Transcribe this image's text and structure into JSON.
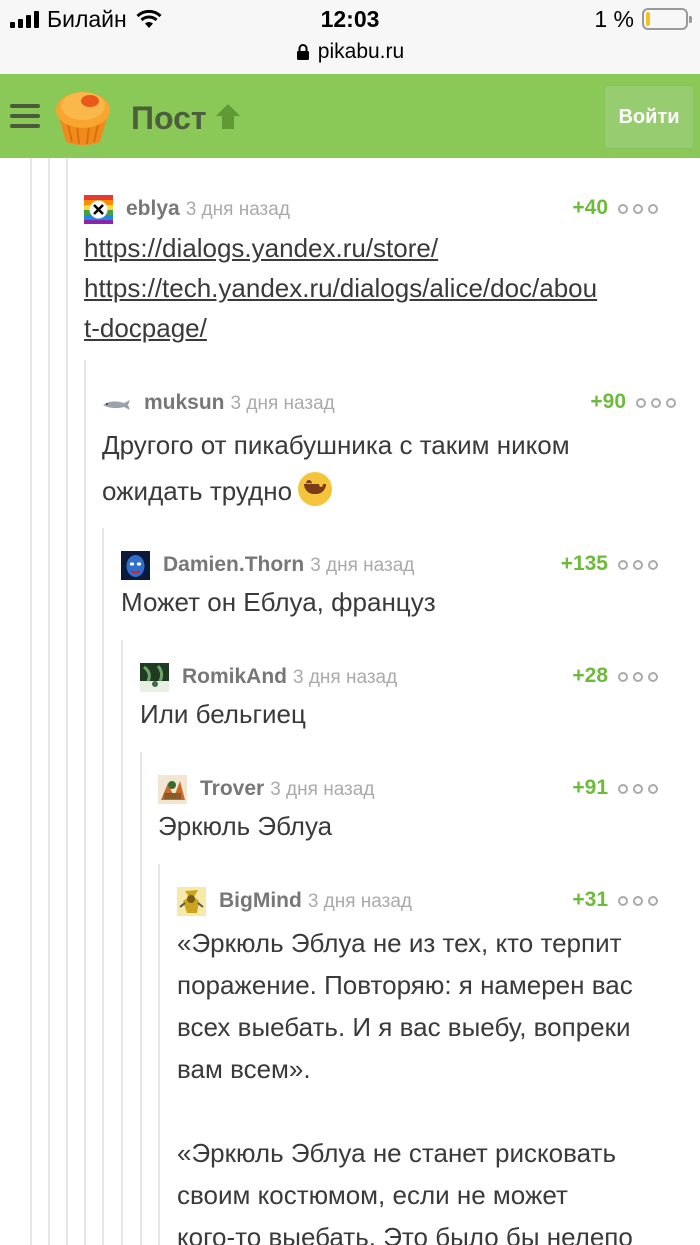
{
  "status": {
    "carrier": "Билайн",
    "time": "12:03",
    "battery": "1 %",
    "url": "pikabu.ru"
  },
  "header": {
    "title": "Пост",
    "login": "Войти"
  },
  "comments": [
    {
      "author": "eblya",
      "time": "3 дня назад",
      "rating": "+40",
      "lines": [
        "https://dialogs.yandex.ru/store/",
        "https://tech.yandex.ru/dialogs/alice/doc/abou",
        "t-docpage/"
      ]
    },
    {
      "author": "muksun",
      "time": "3 дня назад",
      "rating": "+90",
      "lines": [
        "Другого от пикабушника с таким ником",
        "ожидать трудно"
      ],
      "emoji": "grinning-face-emoji"
    },
    {
      "author": "Damien.Thorn",
      "time": "3 дня назад",
      "rating": "+135",
      "lines": [
        "Может он Еблуа, француз"
      ]
    },
    {
      "author": "RomikAnd",
      "time": "3 дня назад",
      "rating": "+28",
      "lines": [
        "Или бельгиец"
      ]
    },
    {
      "author": "Trover",
      "time": "3 дня назад",
      "rating": "+91",
      "lines": [
        "Эркюль Эблуа"
      ]
    },
    {
      "author": "BigMind",
      "time": "3 дня назад",
      "rating": "+31",
      "lines": [
        "«Эркюль Эблуа не из тех, кто терпит",
        "поражение. Повторяю: я намерен вас",
        "всех выебать. И я вас выебу, вопреки",
        "вам всем».",
        "",
        "«Эркюль Эблуа не станет рисковать",
        "своим костюмом, если не может",
        "кого-то выебать. Это было бы нелепо"
      ]
    }
  ]
}
